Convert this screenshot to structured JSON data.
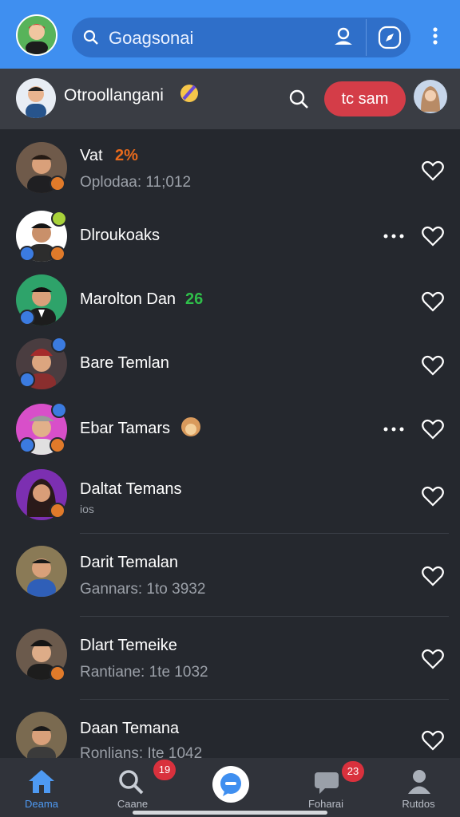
{
  "topbar": {
    "search_value": "Goagsonai"
  },
  "subbar": {
    "title": "Otroollangani",
    "join_label": "tc sam"
  },
  "contacts": [
    {
      "name": "Vat",
      "tag": "2%",
      "tag_color": "#e86a1c",
      "sub": "Oplodaa: 11;012"
    },
    {
      "name": "Dlroukoaks",
      "tag": "",
      "tag_color": "",
      "sub": ""
    },
    {
      "name": "Marolton Dan",
      "tag": "26",
      "tag_color": "#2fbf4a",
      "sub": ""
    },
    {
      "name": "Bare Temlan",
      "tag": "",
      "tag_color": "",
      "sub": ""
    },
    {
      "name": "Ebar Tamars",
      "tag": "",
      "tag_color": "",
      "sub": ""
    },
    {
      "name": "Daltat Temans",
      "tag": "",
      "tag_color": "",
      "sub": "ios"
    },
    {
      "name": "Darit Temalan",
      "tag": "",
      "tag_color": "",
      "sub": "Gannars: 1to 3932"
    },
    {
      "name": "Dlart Temeike",
      "tag": "",
      "tag_color": "",
      "sub": "Rantiane: 1te 1032"
    },
    {
      "name": "Daan Temana",
      "tag": "",
      "tag_color": "",
      "sub": "Ronlians: Ite 1042"
    }
  ],
  "navbar": {
    "items": [
      {
        "label": "Deama",
        "icon": "home-icon"
      },
      {
        "label": "Caane",
        "icon": "search-icon"
      },
      {
        "label": "",
        "icon": "chat-bubble-icon"
      },
      {
        "label": "Foharai",
        "icon": "message-icon"
      },
      {
        "label": "Rutdos",
        "icon": "profile-icon"
      }
    ],
    "badge_search": "19",
    "badge_message": "23"
  },
  "colors": {
    "accent": "#3f8ff0",
    "join": "#d43d48",
    "badge": "#d9313d"
  }
}
